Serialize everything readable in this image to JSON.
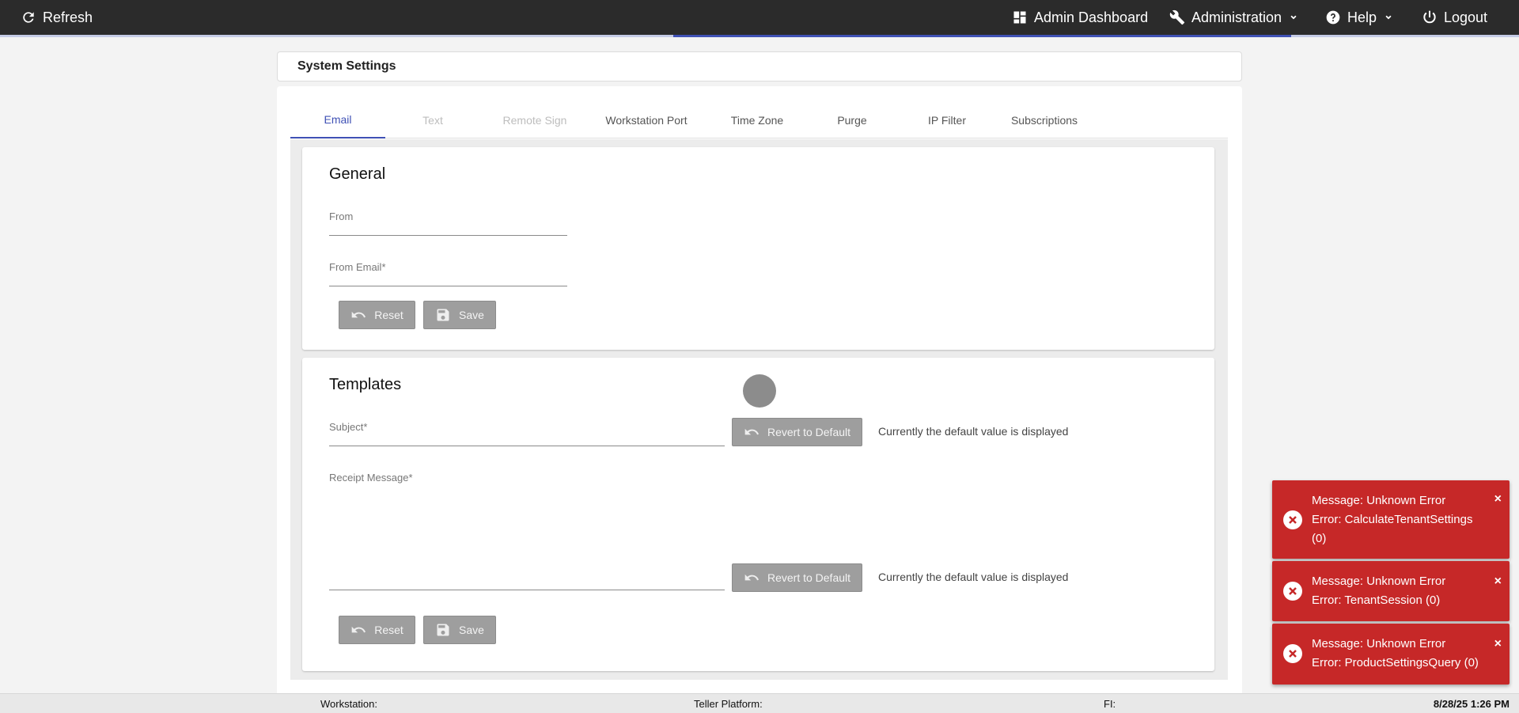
{
  "topbar": {
    "refresh": "Refresh",
    "admin_dashboard": "Admin Dashboard",
    "administration": "Administration",
    "help": "Help",
    "logout": "Logout",
    "accent_color": "#3f51b5"
  },
  "page_title": "System Settings",
  "tabs": [
    {
      "label": "Email",
      "state": "active"
    },
    {
      "label": "Text",
      "state": "disabled"
    },
    {
      "label": "Remote Sign",
      "state": "disabled"
    },
    {
      "label": "Workstation Port",
      "state": "normal"
    },
    {
      "label": "Time Zone",
      "state": "normal"
    },
    {
      "label": "Purge",
      "state": "normal"
    },
    {
      "label": "IP Filter",
      "state": "normal"
    },
    {
      "label": "Subscriptions",
      "state": "normal"
    }
  ],
  "general": {
    "title": "General",
    "from_label": "From",
    "from_value": "",
    "from_email_label": "From Email*",
    "from_email_value": "",
    "reset": "Reset",
    "save": "Save"
  },
  "templates": {
    "title": "Templates",
    "subject_label": "Subject*",
    "subject_value": "",
    "receipt_label": "Receipt Message*",
    "receipt_value": "",
    "revert": "Revert to Default",
    "default_hint": "Currently the default value is displayed",
    "reset": "Reset",
    "save": "Save"
  },
  "statusbar": {
    "workstation": "Workstation:",
    "teller_platform": "Teller Platform:",
    "fi": "FI:",
    "datetime": "8/28/25 1:26 PM"
  },
  "toasts": [
    {
      "message": "Message: Unknown Error",
      "error": "Error: CalculateTenantSettings (0)",
      "close": "×"
    },
    {
      "message": "Message: Unknown Error",
      "error": "Error: TenantSession (0)",
      "close": "×"
    },
    {
      "message": "Message: Unknown Error",
      "error": "Error: ProductSettingsQuery (0)",
      "close": "×"
    }
  ],
  "icons": {
    "refresh": "refresh-icon",
    "dashboard": "dashboard-icon",
    "wrench": "wrench-icon",
    "help": "help-icon",
    "power": "power-icon",
    "undo": "undo-icon",
    "save": "floppy-icon",
    "error": "error-circle-icon"
  },
  "colors": {
    "toast_bg": "#c62828",
    "button_gray": "#9e9e9e",
    "topbar_bg": "#2b2b2b"
  }
}
